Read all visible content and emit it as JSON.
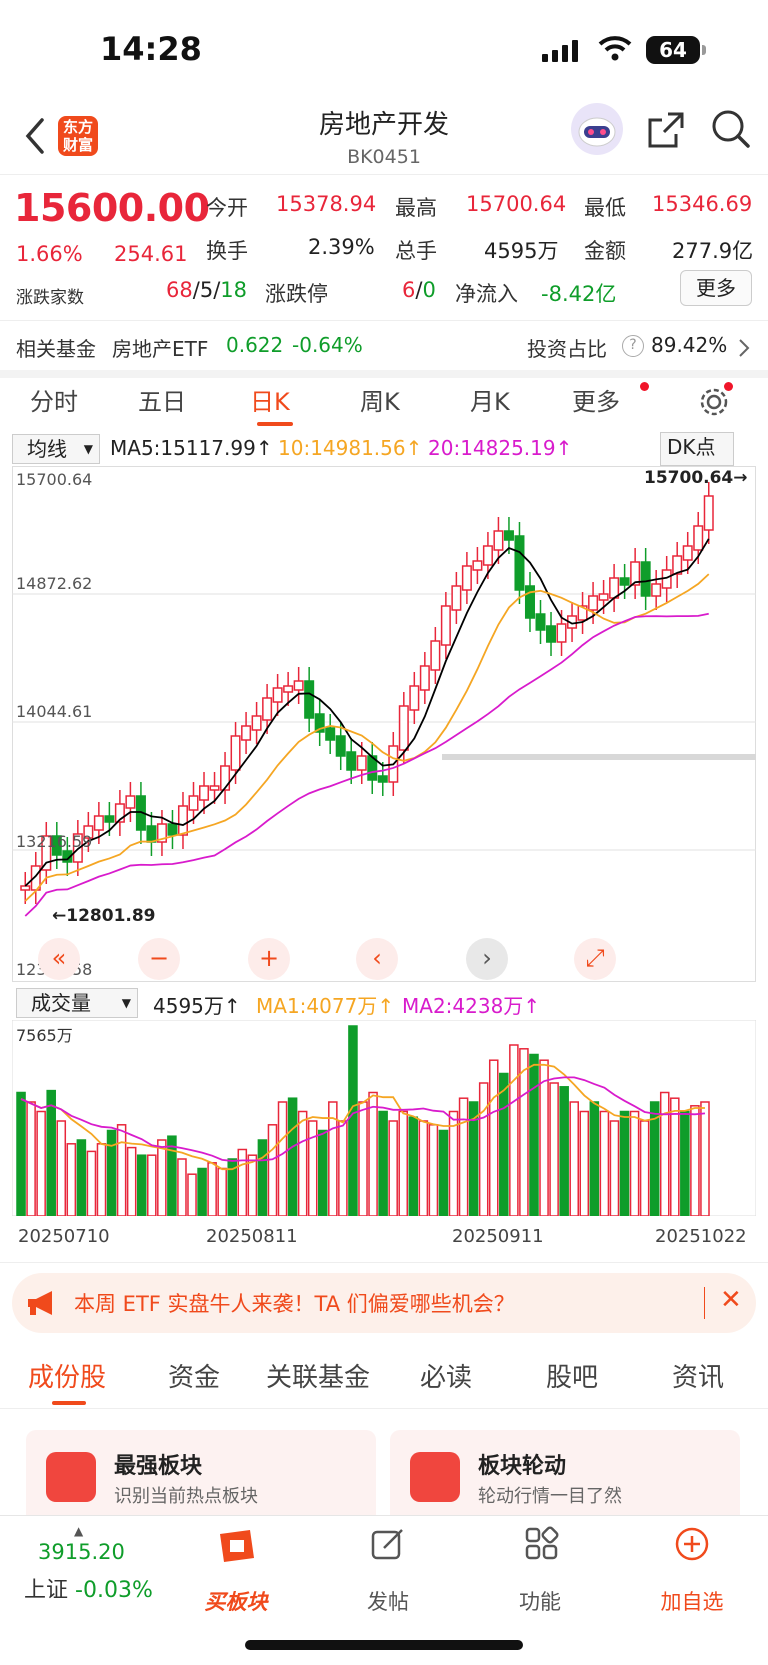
{
  "status": {
    "time": "14:28",
    "battery": "64"
  },
  "nav": {
    "logo_top": "东方",
    "logo_bottom": "财富",
    "title": "房地产开发",
    "code": "BK0451"
  },
  "quote": {
    "price": "15600.00",
    "pct": "1.66%",
    "change": "254.61",
    "open_label": "今开",
    "open": "15378.94",
    "high_label": "最高",
    "high": "15700.64",
    "low_label": "最低",
    "low": "15346.69",
    "turnover_label": "换手",
    "turnover": "2.39%",
    "volume_label": "总手",
    "volume": "4595万",
    "amount_label": "金额",
    "amount": "277.9亿",
    "updown_label": "涨跌家数",
    "up": "68",
    "flat": "5",
    "down": "18",
    "limit_label": "涨跌停",
    "limit_up": "6",
    "limit_down": "0",
    "netflow_label": "净流入",
    "netflow": "-8.42亿",
    "more_btn": "更多"
  },
  "fund": {
    "label": "相关基金",
    "name": "房地产ETF",
    "price": "0.622",
    "pct": "-0.64%",
    "invest_label": "投资占比",
    "invest": "89.42%"
  },
  "tabs": [
    "分时",
    "五日",
    "日K",
    "周K",
    "月K",
    "更多"
  ],
  "active_tab": 2,
  "ma": {
    "select": "均线",
    "ma5": "MA5:15117.99",
    "ma10": "10:14981.56",
    "ma20": "20:14825.19",
    "dk": "DK点"
  },
  "axis": {
    "y1": "15700.64",
    "y2": "14872.62",
    "y3": "14044.61",
    "y4": "13216.59",
    "y5": "12388.58",
    "high_mark": "15700.64",
    "low_mark": "12801.89"
  },
  "vol": {
    "select": "成交量",
    "value": "4595万",
    "ma1": "MA1:4077万",
    "ma2": "MA2:4238万",
    "ymax": "7565万"
  },
  "dates": [
    "20250710",
    "20250811",
    "20250911",
    "20251022"
  ],
  "ad": {
    "text": "本周 ETF 实盘牛人来袭！TA 们偏爱哪些机会？"
  },
  "bottom_tabs": [
    "成份股",
    "资金",
    "关联基金",
    "必读",
    "股吧",
    "资讯"
  ],
  "cards": [
    {
      "title": "最强板块",
      "sub": "识别当前热点板块"
    },
    {
      "title": "板块轮动",
      "sub": "轮动行情一目了然"
    }
  ],
  "bottom_nav": {
    "index_value": "3915.20",
    "index_name": "上证",
    "index_pct": "-0.03%",
    "buy": "买板块",
    "post": "发帖",
    "func": "功能",
    "add": "加自选"
  },
  "colors": {
    "up": "#e8263a",
    "down": "#0f9d2a",
    "accent": "#f04a1c",
    "ma5": "#000000",
    "ma10": "#f5a623",
    "ma20": "#d81bcc"
  }
}
